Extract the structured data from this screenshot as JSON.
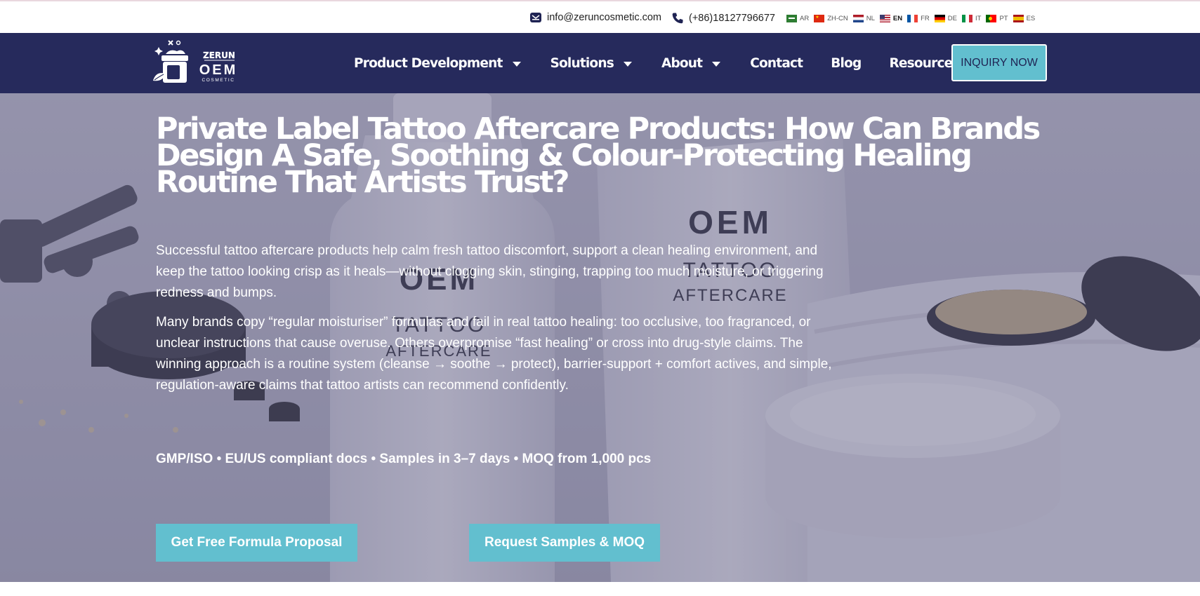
{
  "topbar": {
    "email": "info@zeruncosmetic.com",
    "phone": "(+86)18127796677",
    "languages": [
      {
        "code": "AR",
        "flag": "saudi-flag-icon",
        "active": false
      },
      {
        "code": "ZH-CN",
        "flag": "china-flag-icon",
        "active": false
      },
      {
        "code": "NL",
        "flag": "netherlands-flag-icon",
        "active": false
      },
      {
        "code": "EN",
        "flag": "usa-flag-icon",
        "active": true
      },
      {
        "code": "FR",
        "flag": "france-flag-icon",
        "active": false
      },
      {
        "code": "DE",
        "flag": "germany-flag-icon",
        "active": false
      },
      {
        "code": "IT",
        "flag": "italy-flag-icon",
        "active": false
      },
      {
        "code": "PT",
        "flag": "portugal-flag-icon",
        "active": false
      },
      {
        "code": "ES",
        "flag": "spain-flag-icon",
        "active": false
      }
    ]
  },
  "nav": {
    "logo": {
      "brand": "ZERUN",
      "oem": "OEM",
      "tag": "COSMETIC"
    },
    "items": [
      {
        "label": "Product Development",
        "has_dropdown": true
      },
      {
        "label": "Solutions",
        "has_dropdown": true
      },
      {
        "label": "About",
        "has_dropdown": true
      },
      {
        "label": "Contact",
        "has_dropdown": false
      },
      {
        "label": "Blog",
        "has_dropdown": false
      },
      {
        "label": "Resources",
        "has_dropdown": true
      }
    ],
    "cta_label": "INQUIRY NOW"
  },
  "hero": {
    "title": "Private Label Tattoo Aftercare Products: How Can Brands Design A Safe, Soothing & Colour-Protecting Healing Routine That Artists Trust?",
    "paragraph_1": "Successful tattoo aftercare products help calm fresh tattoo discomfort, support a clean healing environment, and keep the tattoo looking crisp as it heals—without clogging skin, stinging, trapping too much moisture, or triggering redness and bumps.",
    "paragraph_2": "Many brands copy “regular moisturiser” formulas and fail in real tattoo healing: too occlusive, too fragranced, or unclear instructions that cause overuse. Others overpromise “fast healing” or cross into drug-style claims. The winning approach is a routine system (cleanse → soothe → protect), barrier-support + comfort actives, and simple, regulation-aware claims that tattoo artists can recommend confidently.",
    "badges": "GMP/ISO • EU/US compliant docs • Samples in 3–7 days • MOQ from 1,000 pcs",
    "cta_primary": "Get Free Formula Proposal",
    "cta_secondary": "Request Samples & MOQ",
    "image": {
      "bottle_label_1": "OEM",
      "bottle_label_2": "TATTOO",
      "bottle_label_3": "AFTERCARE"
    }
  },
  "colors": {
    "nav_bg": "#262a5c",
    "accent": "#62bfcf",
    "hero_overlay": "#545278",
    "text_light": "#ffffff"
  }
}
